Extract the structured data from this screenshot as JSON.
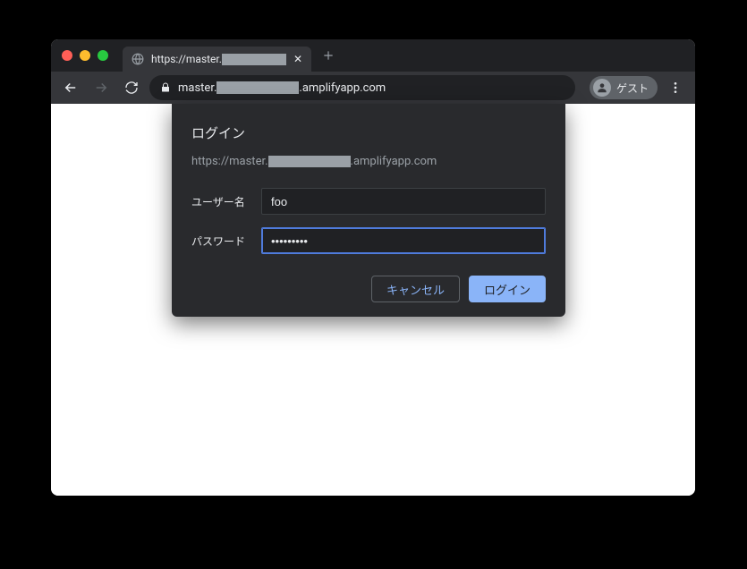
{
  "tab": {
    "title_prefix": "https://master.",
    "close_glyph": "✕"
  },
  "toolbar": {
    "address_prefix": "master.",
    "address_suffix": ".amplifyapp.com",
    "guest_label": "ゲスト"
  },
  "dialog": {
    "title": "ログイン",
    "origin_prefix": "https://master.",
    "origin_suffix": ".amplifyapp.com",
    "username_label": "ユーザー名",
    "username_value": "foo",
    "password_label": "パスワード",
    "password_value": "•••••••••",
    "cancel_label": "キャンセル",
    "login_label": "ログイン"
  }
}
